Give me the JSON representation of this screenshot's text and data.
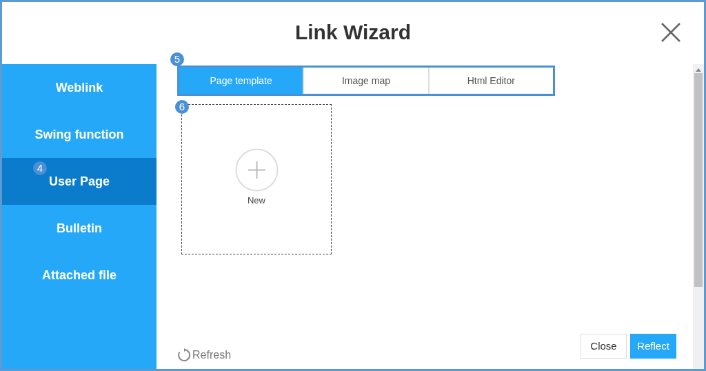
{
  "window": {
    "title": "Link Wizard"
  },
  "sidebar": {
    "items": [
      {
        "label": "Weblink",
        "selected": false
      },
      {
        "label": "Swing function",
        "selected": false
      },
      {
        "label": "User Page",
        "selected": true,
        "callout": "4"
      },
      {
        "label": "Bulletin",
        "selected": false
      },
      {
        "label": "Attached file",
        "selected": false
      }
    ]
  },
  "tabs_callout": "5",
  "tabs": [
    {
      "label": "Page template",
      "selected": true
    },
    {
      "label": "Image map",
      "selected": false
    },
    {
      "label": "Html Editor",
      "selected": false
    }
  ],
  "new_tile": {
    "callout": "6",
    "label": "New"
  },
  "refresh": "Refresh",
  "buttons": [
    {
      "label": "Close",
      "kind": "secondary"
    },
    {
      "label": "Reflect",
      "kind": "primary"
    }
  ]
}
